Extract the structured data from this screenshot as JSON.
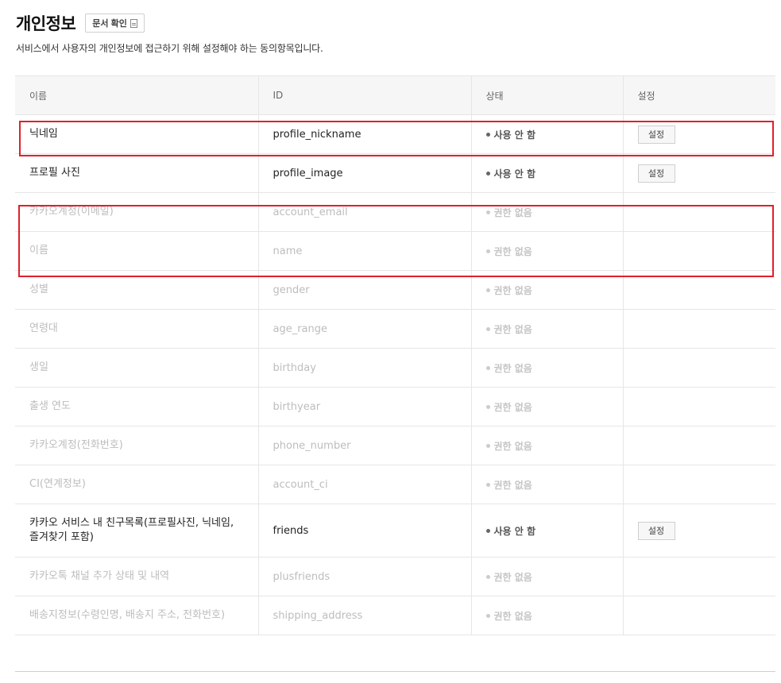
{
  "header": {
    "title": "개인정보",
    "doc_button": "문서 확인"
  },
  "description": "서비스에서 사용자의 개인정보에 접근하기 위해 설정해야 하는 동의항목입니다.",
  "table": {
    "columns": [
      "이름",
      "ID",
      "상태",
      "설정"
    ],
    "rows": [
      {
        "name": "닉네임",
        "id": "profile_nickname",
        "status": "사용 안 함",
        "button": "설정"
      },
      {
        "name": "프로필 사진",
        "id": "profile_image",
        "status": "사용 안 함",
        "button": "설정"
      },
      {
        "name": "카카오계정(이메일)",
        "id": "account_email",
        "status": "권한 없음"
      },
      {
        "name": "이름",
        "id": "name",
        "status": "권한 없음"
      },
      {
        "name": "성별",
        "id": "gender",
        "status": "권한 없음"
      },
      {
        "name": "연령대",
        "id": "age_range",
        "status": "권한 없음"
      },
      {
        "name": "생일",
        "id": "birthday",
        "status": "권한 없음"
      },
      {
        "name": "출생 연도",
        "id": "birthyear",
        "status": "권한 없음"
      },
      {
        "name": "카카오계정(전화번호)",
        "id": "phone_number",
        "status": "권한 없음"
      },
      {
        "name": "CI(연계정보)",
        "id": "account_ci",
        "status": "권한 없음"
      },
      {
        "name": "카카오 서비스 내 친구목록(프로필사진, 닉네임, 즐겨찾기 포함)",
        "id": "friends",
        "status": "사용 안 함",
        "button": "설정"
      },
      {
        "name": "카카오톡 채널 추가 상태 및 내역",
        "id": "plusfriends",
        "status": "권한 없음"
      },
      {
        "name": "배송지정보(수령인명, 배송지 주소, 전화번호)",
        "id": "shipping_address",
        "status": "권한 없음"
      }
    ]
  },
  "colors": {
    "highlight": "#e0202b"
  }
}
